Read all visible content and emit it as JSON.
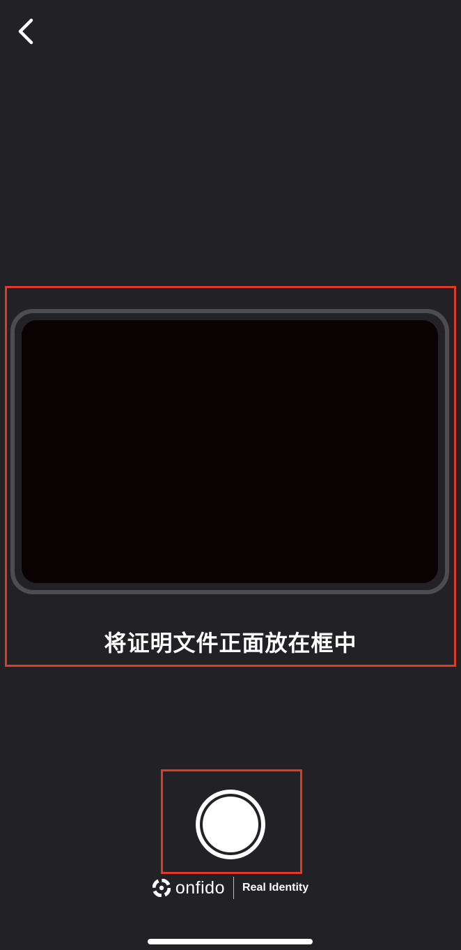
{
  "header": {
    "back_icon": "chevron-left-icon"
  },
  "capture": {
    "instruction": "将证明文件正面放在框中",
    "shutter_icon": "shutter-circle-icon"
  },
  "branding": {
    "logo_icon": "onfido-logo-icon",
    "name": "onfido",
    "tagline": "Real Identity"
  },
  "colors": {
    "background": "#222126",
    "preview": "#0a0103",
    "frame": "#4d4c51",
    "annotation": "#e03a24",
    "text": "#ffffff"
  }
}
